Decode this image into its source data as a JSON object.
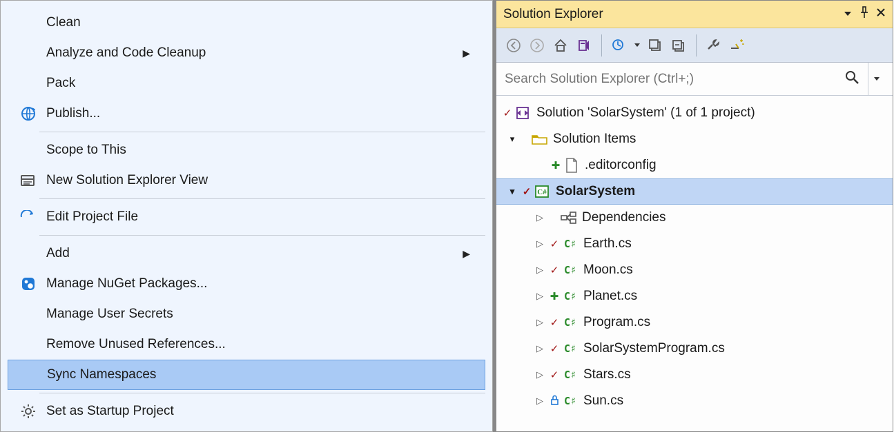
{
  "contextMenu": {
    "items": [
      {
        "label": "Clean",
        "icon": null,
        "arrow": false
      },
      {
        "label": "Analyze and Code Cleanup",
        "icon": null,
        "arrow": true
      },
      {
        "label": "Pack",
        "icon": null,
        "arrow": false
      },
      {
        "label": "Publish...",
        "icon": "globe",
        "arrow": false
      },
      {
        "sep": true
      },
      {
        "label": "Scope to This",
        "icon": null,
        "arrow": false
      },
      {
        "label": "New Solution Explorer View",
        "icon": "explorer-view",
        "arrow": false
      },
      {
        "sep": true
      },
      {
        "label": "Edit Project File",
        "icon": "edit-arrow",
        "arrow": false
      },
      {
        "sep": true
      },
      {
        "label": "Add",
        "icon": null,
        "arrow": true
      },
      {
        "label": "Manage NuGet Packages...",
        "icon": "nuget",
        "arrow": false
      },
      {
        "label": "Manage User Secrets",
        "icon": null,
        "arrow": false
      },
      {
        "label": "Remove Unused References...",
        "icon": null,
        "arrow": false
      },
      {
        "label": "Sync Namespaces",
        "icon": null,
        "arrow": false,
        "hovered": true
      },
      {
        "sep": true
      },
      {
        "label": "Set as Startup Project",
        "icon": "gear",
        "arrow": false
      }
    ]
  },
  "panel": {
    "title": "Solution Explorer",
    "searchPlaceholder": "Search Solution Explorer (Ctrl+;)"
  },
  "tree": {
    "solution": "Solution 'SolarSystem' (1 of 1 project)",
    "solutionItems": "Solution Items",
    "editorconfig": ".editorconfig",
    "project": "SolarSystem",
    "dependencies": "Dependencies",
    "files": [
      {
        "name": "Earth.cs",
        "status": "check"
      },
      {
        "name": "Moon.cs",
        "status": "check"
      },
      {
        "name": "Planet.cs",
        "status": "plus"
      },
      {
        "name": "Program.cs",
        "status": "check"
      },
      {
        "name": "SolarSystemProgram.cs",
        "status": "check"
      },
      {
        "name": "Stars.cs",
        "status": "check"
      },
      {
        "name": "Sun.cs",
        "status": "lock"
      }
    ]
  }
}
